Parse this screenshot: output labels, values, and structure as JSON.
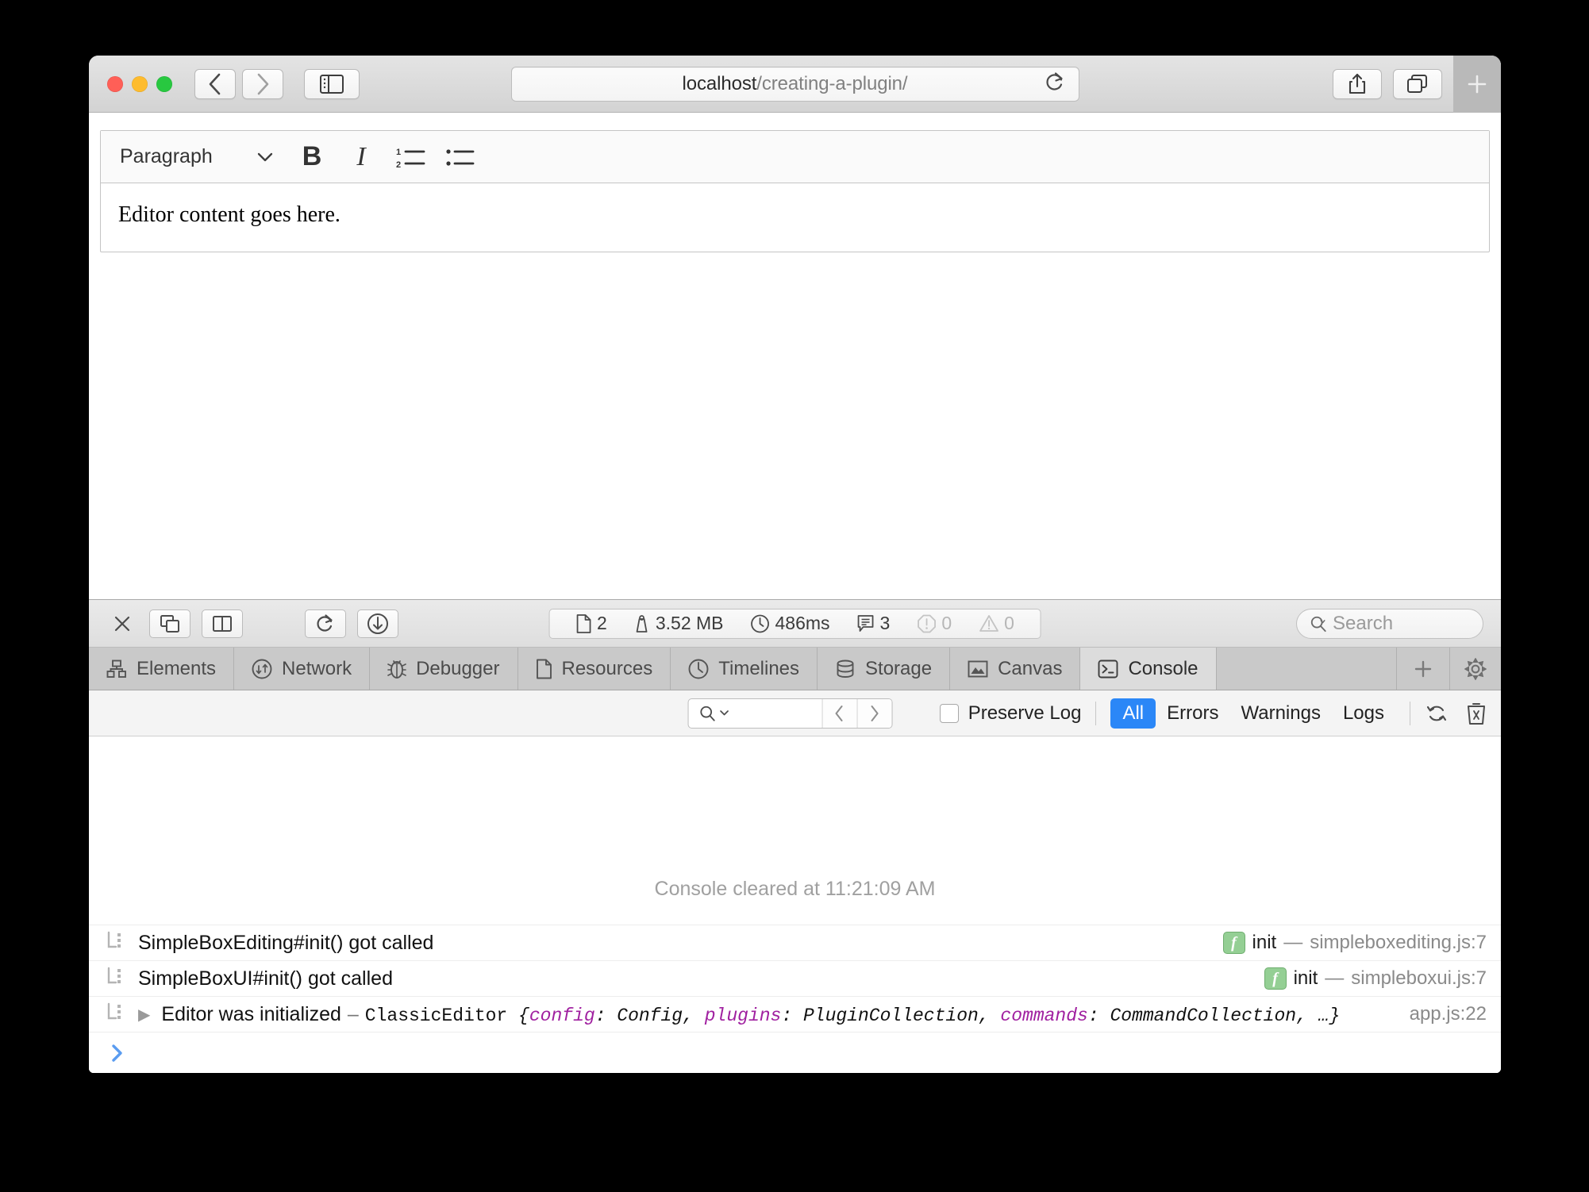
{
  "browser": {
    "url_host": "localhost",
    "url_path": "/creating-a-plugin/",
    "back_icon": "chevron-left-icon",
    "forward_icon": "chevron-right-icon",
    "sidebar_icon": "sidebar-icon",
    "reload_icon": "reload-icon",
    "share_icon": "share-icon",
    "tab_overview_icon": "tab-overview-icon",
    "new_tab_label": "+"
  },
  "editor": {
    "style_dropdown": "Paragraph",
    "buttons": [
      {
        "name": "bold-button",
        "label": "B"
      },
      {
        "name": "italic-button",
        "label": "I"
      },
      {
        "name": "numbered-list-button",
        "label": ""
      },
      {
        "name": "bulleted-list-button",
        "label": ""
      }
    ],
    "content": "Editor content goes here."
  },
  "inspector": {
    "close_label": "×",
    "dock_icons": [
      "dock-undock-icon",
      "dock-side-icon"
    ],
    "action_icons": [
      "reload-page-icon",
      "download-icon"
    ],
    "node_picker_icon": "node-picker-icon",
    "search_placeholder": "Search",
    "stats": [
      {
        "icon": "resource-icon",
        "value": "2",
        "dim": false
      },
      {
        "icon": "weight-icon",
        "value": "3.52 MB",
        "dim": false
      },
      {
        "icon": "clock-icon",
        "value": "486ms",
        "dim": false
      },
      {
        "icon": "message-icon",
        "value": "3",
        "dim": false
      },
      {
        "icon": "error-icon",
        "value": "0",
        "dim": true
      },
      {
        "icon": "warning-icon",
        "value": "0",
        "dim": true
      }
    ],
    "tabs": [
      {
        "label": "Elements",
        "icon": "elements-icon",
        "active": false
      },
      {
        "label": "Network",
        "icon": "network-icon",
        "active": false
      },
      {
        "label": "Debugger",
        "icon": "debugger-icon",
        "active": false
      },
      {
        "label": "Resources",
        "icon": "resources-icon",
        "active": false
      },
      {
        "label": "Timelines",
        "icon": "timelines-icon",
        "active": false
      },
      {
        "label": "Storage",
        "icon": "storage-icon",
        "active": false
      },
      {
        "label": "Canvas",
        "icon": "canvas-icon",
        "active": false
      },
      {
        "label": "Console",
        "icon": "console-icon",
        "active": true
      }
    ],
    "add_tab_label": "+",
    "settings_icon": "gear-icon"
  },
  "console": {
    "find_placeholder": "",
    "prev_icon": "chevron-left-icon",
    "next_icon": "chevron-right-icon",
    "preserve_log_label": "Preserve Log",
    "preserve_log_checked": false,
    "filters": [
      {
        "label": "All",
        "selected": true
      },
      {
        "label": "Errors",
        "selected": false
      },
      {
        "label": "Warnings",
        "selected": false
      },
      {
        "label": "Logs",
        "selected": false
      }
    ],
    "refresh_icon": "refresh-icon",
    "clear_icon": "trash-icon",
    "cleared_notice": "Console cleared at 11:21:09 AM",
    "messages": [
      {
        "level_icon": "log-level-icon",
        "text": "SimpleBoxEditing#init() got called",
        "has_disclosure": false,
        "source_badge": "f",
        "source_fn": "init",
        "source_dash": "—",
        "source_file": "simpleboxediting.js:7"
      },
      {
        "level_icon": "log-level-icon",
        "text": "SimpleBoxUI#init() got called",
        "has_disclosure": false,
        "source_badge": "f",
        "source_fn": "init",
        "source_dash": "—",
        "source_file": "simpleboxui.js:7"
      },
      {
        "level_icon": "log-level-icon",
        "text": "Editor was initialized",
        "has_disclosure": true,
        "dash": "–",
        "object_class": "ClassicEditor",
        "object_open": "{",
        "props": [
          {
            "key": "config",
            "value": "Config"
          },
          {
            "key": "plugins",
            "value": "PluginCollection"
          },
          {
            "key": "commands",
            "value": "CommandCollection"
          }
        ],
        "object_more": "…}",
        "source_file": "app.js:22"
      }
    ],
    "prompt_icon": "prompt-chevron-icon"
  },
  "colors": {
    "accent_blue": "#2b87f7",
    "prompt_blue": "#5a9cf0",
    "key_purple": "#a020a0",
    "badge_green": "#94cf94"
  }
}
